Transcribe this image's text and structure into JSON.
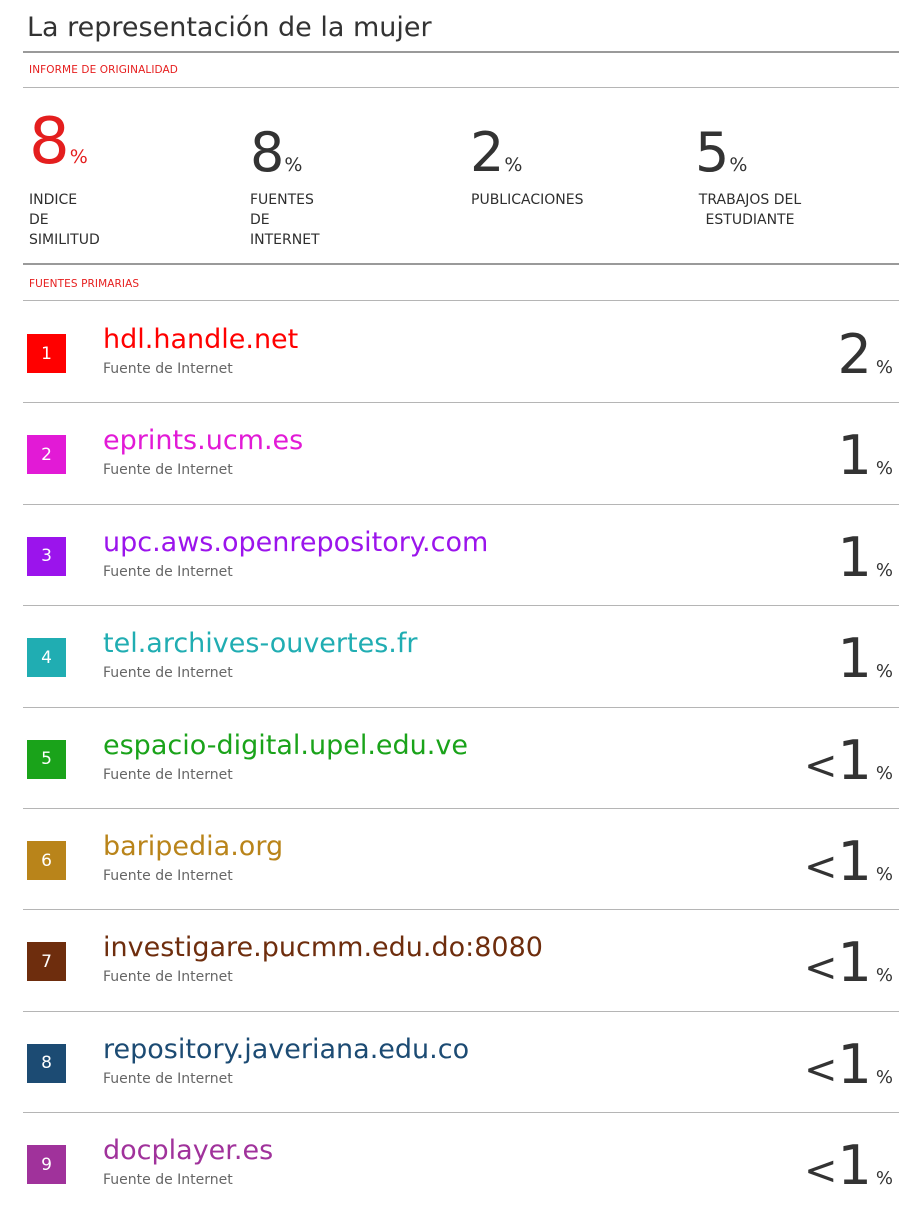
{
  "title": "La representación de la mujer",
  "report_label": "INFORME DE ORIGINALIDAD",
  "stats": [
    {
      "value": "8",
      "unit": "%",
      "label": "INDICE DE SIMILITUD"
    },
    {
      "value": "8",
      "unit": "%",
      "label": "FUENTES DE INTERNET"
    },
    {
      "value": "2",
      "unit": "%",
      "label": "PUBLICACIONES"
    },
    {
      "value": "5",
      "unit": "%",
      "label": "TRABAJOS DEL\nESTUDIANTE"
    }
  ],
  "primary_label": "FUENTES PRIMARIAS",
  "sources": [
    {
      "rank": "1",
      "name": "hdl.handle.net",
      "type": "Fuente de Internet",
      "prefix": "",
      "value": "2",
      "unit": "%",
      "color": "#ff0000"
    },
    {
      "rank": "2",
      "name": "eprints.ucm.es",
      "type": "Fuente de Internet",
      "prefix": "",
      "value": "1",
      "unit": "%",
      "color": "#e21ad6"
    },
    {
      "rank": "3",
      "name": "upc.aws.openrepository.com",
      "type": "Fuente de Internet",
      "prefix": "",
      "value": "1",
      "unit": "%",
      "color": "#9b14ec"
    },
    {
      "rank": "4",
      "name": "tel.archives-ouvertes.fr",
      "type": "Fuente de Internet",
      "prefix": "",
      "value": "1",
      "unit": "%",
      "color": "#20adb2"
    },
    {
      "rank": "5",
      "name": "espacio-digital.upel.edu.ve",
      "type": "Fuente de Internet",
      "prefix": "<",
      "value": "1",
      "unit": "%",
      "color": "#1aa31a"
    },
    {
      "rank": "6",
      "name": "baripedia.org",
      "type": "Fuente de Internet",
      "prefix": "<",
      "value": "1",
      "unit": "%",
      "color": "#b9841a"
    },
    {
      "rank": "7",
      "name": "investigare.pucmm.edu.do:8080",
      "type": "Fuente de Internet",
      "prefix": "<",
      "value": "1",
      "unit": "%",
      "color": "#6e2d0d"
    },
    {
      "rank": "8",
      "name": "repository.javeriana.edu.co",
      "type": "Fuente de Internet",
      "prefix": "<",
      "value": "1",
      "unit": "%",
      "color": "#1c4b73"
    },
    {
      "rank": "9",
      "name": "docplayer.es",
      "type": "Fuente de Internet",
      "prefix": "<",
      "value": "1",
      "unit": "%",
      "color": "#a0329b"
    }
  ]
}
